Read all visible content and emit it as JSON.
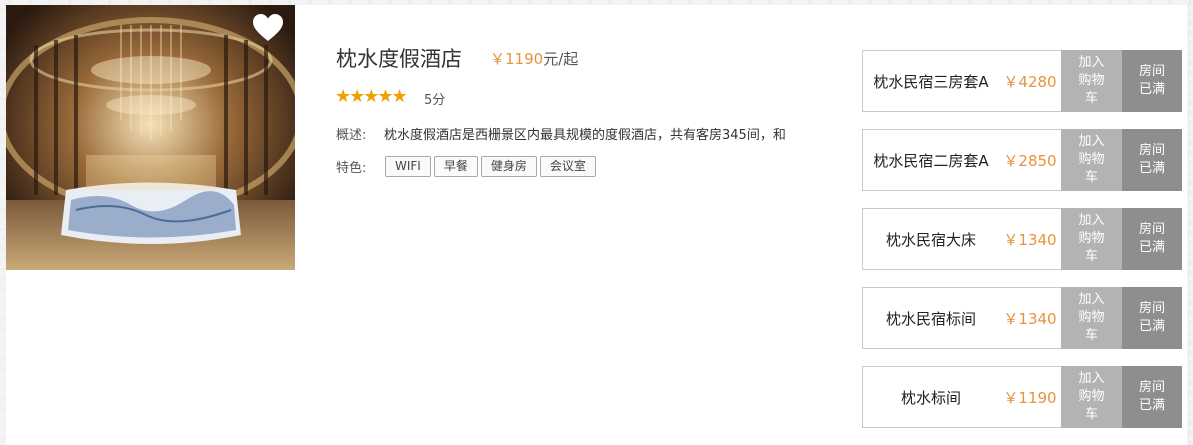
{
  "hotel": {
    "name": "枕水度假酒店",
    "price": "￥1190",
    "price_unit": "元/起",
    "stars": "★★★★★",
    "score": "5分",
    "desc_label": "概述:",
    "description": "枕水度假酒店是西栅景区内最具规模的度假酒店，共有客房345间，和",
    "features_label": "特色:",
    "features": [
      "WIFI",
      "早餐",
      "健身房",
      "会议室"
    ]
  },
  "rooms": [
    {
      "name": "枕水民宿三房套A",
      "price": "￥4280",
      "cart": "加入购物车",
      "status": "房间已满"
    },
    {
      "name": "枕水民宿二房套A",
      "price": "￥2850",
      "cart": "加入购物车",
      "status": "房间已满"
    },
    {
      "name": "枕水民宿大床",
      "price": "￥1340",
      "cart": "加入购物车",
      "status": "房间已满"
    },
    {
      "name": "枕水民宿标间",
      "price": "￥1340",
      "cart": "加入购物车",
      "status": "房间已满"
    },
    {
      "name": "枕水标间",
      "price": "￥1190",
      "cart": "加入购物车",
      "status": "房间已满"
    }
  ],
  "colors": {
    "price": "#e8943a",
    "star": "#f0a000",
    "cart_bg": "#b3b3b3",
    "full_bg": "#8e8e8e"
  },
  "icons": {
    "favorite": "heart-icon"
  }
}
